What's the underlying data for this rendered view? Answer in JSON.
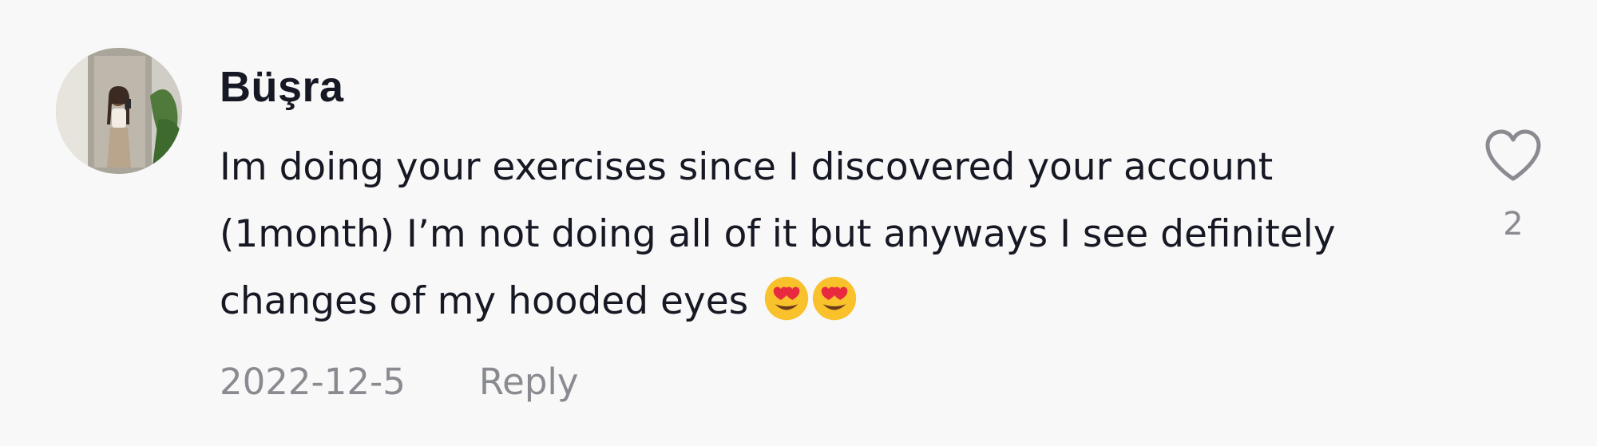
{
  "comment": {
    "username": "Büşra",
    "text": "Im doing your exercises since I discovered your account (1month) I’m not doing all of it but anyways I see definitely changes of my hooded eyes",
    "emojis": [
      "heart-eyes-emoji",
      "heart-eyes-emoji"
    ],
    "date": "2022-12-5",
    "reply_label": "Reply",
    "like_count": "2"
  },
  "icons": {
    "like": "heart-outline-icon",
    "avatar": "user-avatar"
  },
  "colors": {
    "background": "#f8f8f8",
    "primary_text": "#161823",
    "secondary_text": "#8a8b91",
    "emoji_face": "#f9c12c",
    "emoji_heart": "#e8293f"
  }
}
